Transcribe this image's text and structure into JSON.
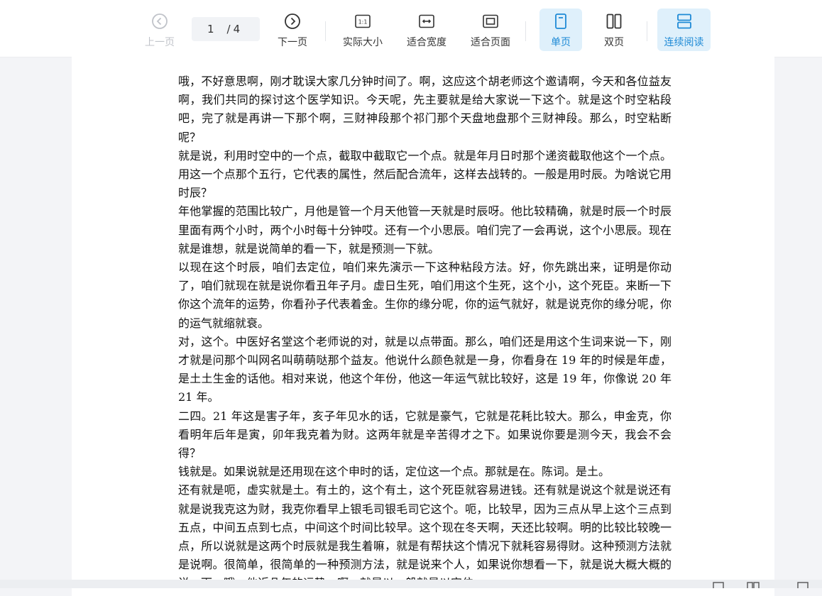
{
  "toolbar": {
    "prev": "上一页",
    "page_current": "1",
    "page_sep": "/",
    "page_total": "4",
    "next": "下一页",
    "actual_size": "实际大小",
    "fit_width": "适合宽度",
    "fit_page": "适合页面",
    "single_page": "单页",
    "double_page": "双页",
    "continuous": "连续阅读"
  },
  "colors": {
    "accent": "#1e8ad6",
    "active_bg": "#dff0fb",
    "disabled": "#c0c3c9"
  },
  "document": {
    "paragraphs": [
      "哦，不好意思啊，刚才耽误大家几分钟时间了。啊，这应这个胡老师这个邀请啊，今天和各位益友啊，我们共同的探讨这个医学知识。今天呢，先主要就是给大家说一下这个。就是这个时空粘段吧，完了就是再讲一下那个啊，三财神段那个祁门那个天盘地盘那个三财神段。那么，时空粘断呢？",
      "就是说，利用时空中的一个点，截取中截取它一个点。就是年月日时那个递资截取他这个一个点。用这一个点那个五行，它代表的属性，然后配合流年，这样去战转的。一般是用时辰。为啥说它用时辰？",
      "年他掌握的范围比较广，月他是管一个月天他管一天就是时辰呀。他比较精确，就是时辰一个时辰里面有两个小时，两个小时每十分钟哎。还有一个小思辰。咱们完了一会再说，这个小思辰。现在就是谁想，就是说简单的看一下，就是预测一下就。",
      "以现在这个时辰，咱们去定位，咱们来先演示一下这种粘段方法。好，你先跳出来，证明是你动了，咱们就现在就是说你看丑年子月。虚日生死，咱们用这个生死，这个小，这个死臣。来断一下你这个流年的运势，你看孙子代表着金。生你的缘分呢，你的运气就好，就是说克你的缘分呢，你的运气就缩就衰。",
      "对，这个。中医好名堂这个老师说的对，就是以点带面。那么，咱们还是用这个生词来说一下，刚才就是问那个叫网名叫萌萌哒那个益友。他说什么颜色就是一身，你看身在 19 年的时候是年虚，是土土生金的话他。相对来说，他这个年份，他这一年运气就比较好，这是 19 年，你像说 20 年 21 年。",
      "二四。21 年这是害子年，亥子年见水的话，它就是豪气，它就是花耗比较大。那么，申金克，你看明年后年是寅，卯年我克着为财。这两年就是辛苦得才之下。如果说你要是测今天，我会不会得？",
      "钱就是。如果说就是还用现在这个申时的话，定位这一个点。那就是在。陈词。是土。",
      "还有就是呃，虚实就是土。有土的，这个有土，这个死臣就容易进钱。还有就是说这个就是说还有就是说我克这为财，我克你看早上银毛司银毛司它这个。呃，比较早，因为三点从早上这个三点到五点，中间五点到七点，中间这个时间比较早。这个现在冬天啊，天还比较啊。明的比较比较晚一点，所以说就是这两个时辰就是我生着嘛，就是有帮扶这个情况下就耗容易得财。这种预测方法就是说啊。很简单，很简单的一种预测方法，就是说来个人，如果说你想看一下，就是说大概大概的说一下。哦，他近几年的运势。啊，就是以一般就是以定位"
    ]
  }
}
